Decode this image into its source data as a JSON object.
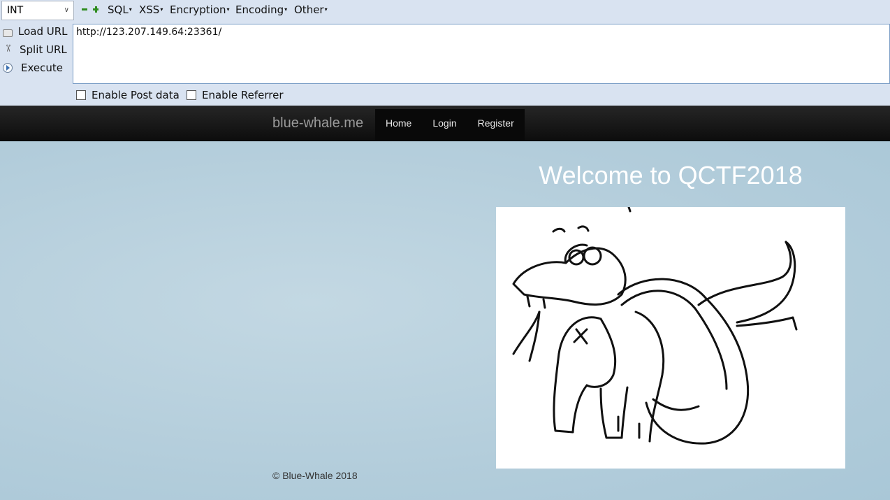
{
  "hackbar": {
    "select_value": "INT",
    "menus": [
      "SQL",
      "XSS",
      "Encryption",
      "Encoding",
      "Other"
    ],
    "side_actions": [
      {
        "label": "Load URL",
        "icon": "load-url-icon"
      },
      {
        "label": "Split URL",
        "icon": "scissors-icon"
      },
      {
        "label": "Execute",
        "icon": "play-icon"
      }
    ],
    "url_value": "http://123.207.149.64:23361/",
    "checkboxes": [
      "Enable Post data",
      "Enable Referrer"
    ],
    "accent_color": "#2f8c1f"
  },
  "navbar": {
    "brand": "blue-whale.me",
    "items": [
      "Home",
      "Login",
      "Register"
    ]
  },
  "main": {
    "heading": "Welcome to QCTF2018",
    "footer": "© Blue-Whale 2018"
  }
}
